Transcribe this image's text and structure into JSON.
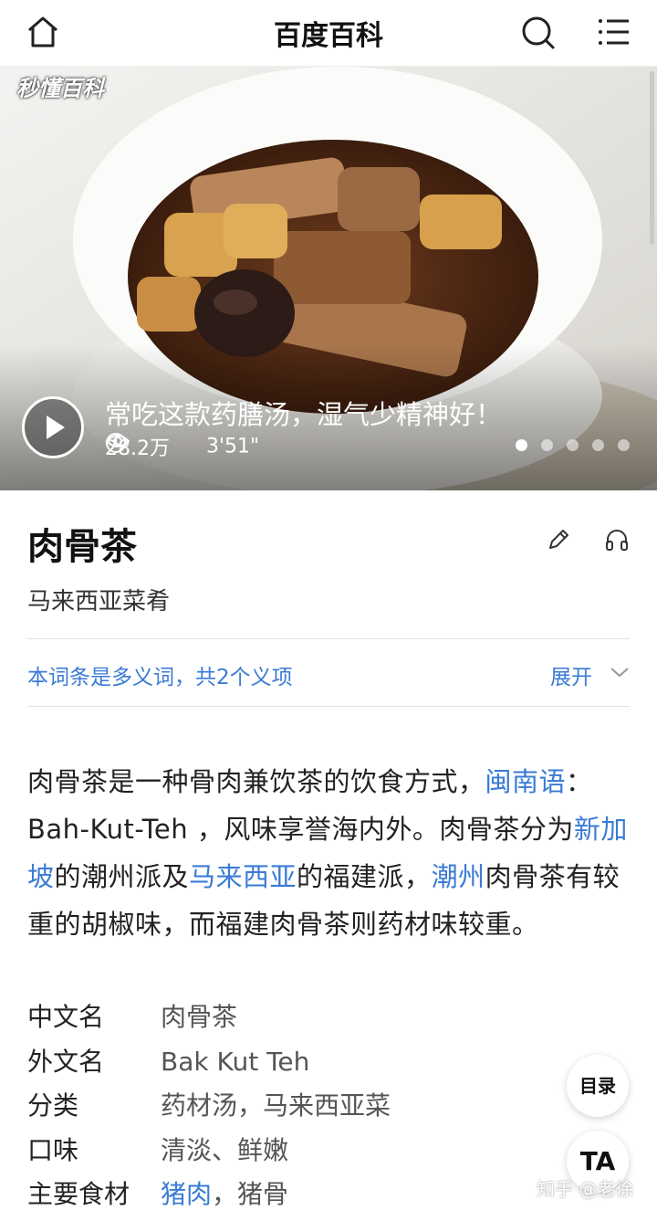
{
  "header": {
    "title": "百度百科"
  },
  "video": {
    "logo_text": "秒懂百科",
    "caption": "常吃这款药膳汤，湿气少精神好！",
    "views": "28.2万",
    "duration": "3'51\"",
    "slide_count": 5,
    "active_slide": 1
  },
  "entry": {
    "title": "肉骨茶",
    "subtitle": "马来西亚菜肴"
  },
  "polysemy": {
    "text": "本词条是多义词，共2个义项",
    "expand_label": "展开"
  },
  "summary": {
    "part1": "肉骨茶是一种骨肉兼饮茶的饮食方式，",
    "link1": "闽南语",
    "part2": "：Bah-Kut-Teh ，风味享誉海内外。肉骨茶分为",
    "link2": "新加坡",
    "part3": "的潮州派及",
    "link3": "马来西亚",
    "part4": "的福建派，",
    "link4": "潮州",
    "part5": "肉骨茶有较重的胡椒味，而福建肉骨茶则药材味较重。"
  },
  "infobox": {
    "rows": [
      {
        "key": "中文名",
        "value": "肉骨茶"
      },
      {
        "key": "外文名",
        "value": "Bak Kut Teh"
      },
      {
        "key": "分类",
        "value": "药材汤，马来西亚菜"
      },
      {
        "key": "口味",
        "value": "清淡、鲜嫩"
      },
      {
        "key": "主要食材",
        "value_link": "猪肉",
        "value_rest": "，猪骨"
      }
    ]
  },
  "floating": {
    "toc_label": "目录",
    "font_label": "TA"
  },
  "watermark": "知乎 @老徐",
  "colors": {
    "link": "#3a7bd5",
    "text": "#222222"
  }
}
